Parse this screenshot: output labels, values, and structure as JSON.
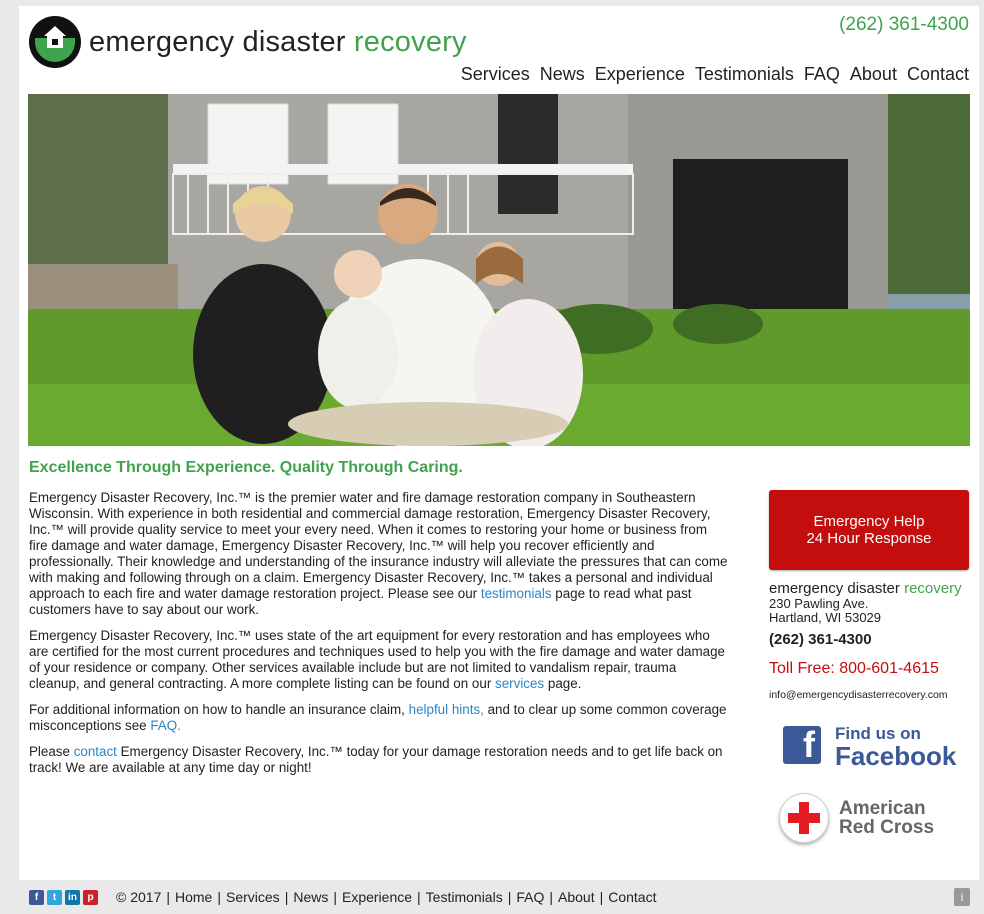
{
  "header": {
    "logo_text_a": "emergency disaster",
    "logo_text_b": "recovery",
    "phone": "(262) 361-4300",
    "nav": [
      "Services",
      "News",
      "Experience",
      "Testimonials",
      "FAQ",
      "About",
      "Contact"
    ]
  },
  "tagline": "Excellence Through Experience. Quality Through Caring.",
  "content": {
    "p1a": "Emergency Disaster Recovery, Inc.™ is the premier water and fire damage restoration company in Southeastern Wisconsin. With experience in both residential and commercial damage restoration, Emergency Disaster Recovery, Inc.™ will provide quality service to meet your every need. When it comes to restoring your home or business from fire damage and water damage, Emergency Disaster Recovery, Inc.™ will help you recover efficiently and professionally. Their knowledge and understanding of the insurance industry will alleviate the pressures that can come with making and following through on a claim. Emergency Disaster Recovery, Inc.™ takes a personal and individual approach to each fire and water damage restoration project. Please see our",
    "p1_link": "testimonials",
    "p1b": "page to read what past customers have to say about our work.",
    "p2a": "Emergency Disaster Recovery, Inc.™ uses state of the art equipment for every restoration and has employees who are certified for the most current procedures and techniques used to help you with the fire damage and water damage of your residence or company. Other services available include but are not limited to vandalism repair, trauma cleanup, and general contracting. A more complete listing can be found on our",
    "p2_link": "services",
    "p2b": "page.",
    "p3a": "For additional information on how to handle an insurance claim,",
    "p3_link1": "helpful hints,",
    "p3b": "and to clear up some common coverage misconceptions see",
    "p3_link2": "FAQ.",
    "p4a": "Please",
    "p4_link": "contact",
    "p4b": "Emergency Disaster Recovery, Inc.™ today for your damage restoration needs and to get life back on track! We are available at any time day or night!"
  },
  "sidebar": {
    "emergency_line1": "Emergency Help",
    "emergency_line2": "24 Hour Response",
    "logo_a": "emergency disaster",
    "logo_b": "recovery",
    "address1": "230 Pawling Ave.",
    "address2": "Hartland, WI 53029",
    "phone": "(262) 361-4300",
    "tollfree": "Toll Free: 800-601-4615",
    "email": "info@emergencydisasterrecovery.com",
    "fb_line1": "Find us on",
    "fb_line2": "Facebook",
    "rc_line1": "American",
    "rc_line2": "Red Cross"
  },
  "footer": {
    "copyright": "© 2017",
    "links": [
      "Home",
      "Services",
      "News",
      "Experience",
      "Testimonials",
      "FAQ",
      "About",
      "Contact"
    ]
  },
  "colors": {
    "green": "#3fa34d",
    "red": "#c40d0d",
    "link": "#2a86c8",
    "facebook": "#3b5998"
  }
}
